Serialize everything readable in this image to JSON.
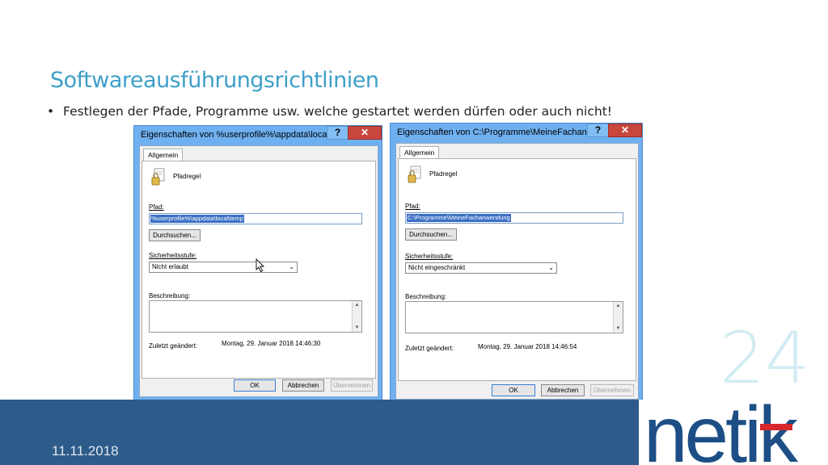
{
  "slide": {
    "title": "Softwareausführungsrichtlinien",
    "bullet": "Festlegen der Pfade, Programme usw. welche gestartet werden dürfen oder auch nicht!",
    "slide_number": "24",
    "date": "11.11.2018",
    "logo_text": "netik"
  },
  "dialogs": [
    {
      "title": "Eigenschaften von %userprofile%\\appdata\\loca...",
      "tab": "Allgemein",
      "rule_type": "Pfadregel",
      "path_label": "Pfad:",
      "path_value": "%userprofile%\\appdata\\local\\temp",
      "browse_label": "Durchsuchen...",
      "security_label": "Sicherheitsstufe:",
      "security_value": "Nicht erlaubt",
      "description_label": "Beschreibung:",
      "last_changed_label": "Zuletzt geändert:",
      "last_changed_value": "Montag, 29. Januar 2018   14:46:30",
      "ok": "OK",
      "cancel": "Abbrechen",
      "apply": "Übernehmen"
    },
    {
      "title": "Eigenschaften von C:\\Programme\\MeineFachan...",
      "tab": "Allgemein",
      "rule_type": "Pfadregel",
      "path_label": "Pfad:",
      "path_value": "C:\\Programme\\MeineFachanwendung",
      "browse_label": "Durchsuchen...",
      "security_label": "Sicherheitsstufe:",
      "security_value": "Nicht eingeschränkt",
      "description_label": "Beschreibung:",
      "last_changed_label": "Zuletzt geändert:",
      "last_changed_value": "Montag, 29. Januar 2018   14:46:54",
      "ok": "OK",
      "cancel": "Abbrechen",
      "apply": "Übernehmen"
    }
  ],
  "icons": {
    "minimize": "minimize-icon",
    "close": "close-icon",
    "rule": "path-rule-icon",
    "cursor": "mouse-cursor-icon"
  },
  "colors": {
    "title": "#3e9fc8",
    "footer": "#2e5c8a",
    "window_frame": "#6fb0f0",
    "close_button": "#c9463d",
    "logo": "#1d4f86",
    "logo_accent": "#d7262c"
  }
}
